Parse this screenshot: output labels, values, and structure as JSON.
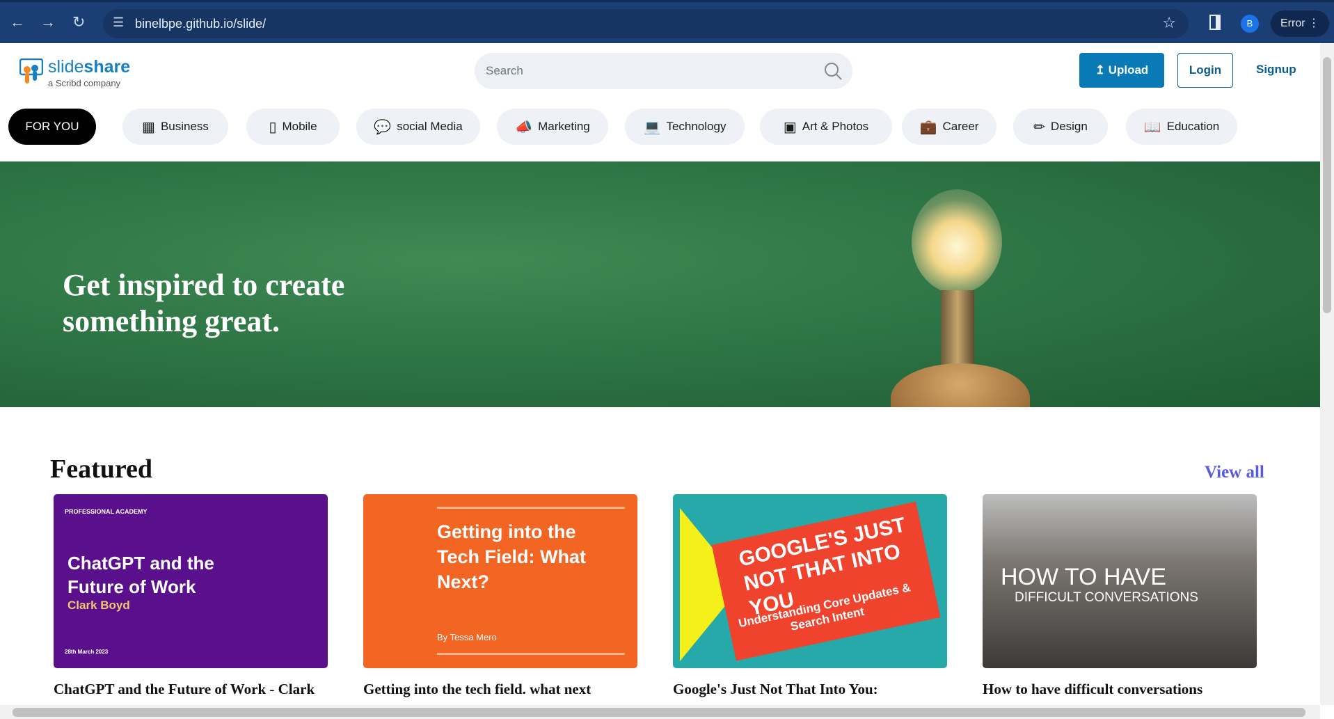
{
  "browser": {
    "url": "binelbpe.github.io/slide/",
    "profile_initial": "B",
    "error_label": "Error"
  },
  "header": {
    "logo_name_light": "slide",
    "logo_name_bold": "share",
    "logo_sub": "a Scribd company",
    "search_placeholder": "Search",
    "upload": "Upload",
    "login": "Login",
    "signup": "Signup"
  },
  "categories": [
    {
      "label": "FOR YOU",
      "icon": "none"
    },
    {
      "label": "Business",
      "icon": "building-icon"
    },
    {
      "label": "Mobile",
      "icon": "phone-icon"
    },
    {
      "label": "social Media",
      "icon": "chat-icon"
    },
    {
      "label": "Marketing",
      "icon": "megaphone-icon"
    },
    {
      "label": "Technology",
      "icon": "monitor-icon"
    },
    {
      "label": "Art & Photos",
      "icon": "image-icon"
    },
    {
      "label": "Career",
      "icon": "briefcase-icon"
    },
    {
      "label": "Design",
      "icon": "brush-icon"
    },
    {
      "label": "Education",
      "icon": "book-icon"
    }
  ],
  "hero": {
    "line1": "Get inspired to create",
    "line2": "something great."
  },
  "featured": {
    "title": "Featured",
    "view_all": "View all",
    "cards": [
      {
        "title": "ChatGPT and the Future of Work - Clark",
        "thumb_text": "ChatGPT and the Future of Work",
        "thumb_sub": "Clark Boyd",
        "thumb_org": "PROFESSIONAL ACADEMY",
        "thumb_date": "28th March 2023",
        "color": "#5a0f8c"
      },
      {
        "title": "Getting into the tech field. what next",
        "thumb_text": "Getting into the Tech Field: What Next?",
        "thumb_sub": "By Tessa Mero",
        "color": "#f26522"
      },
      {
        "title": "Google's Just Not That Into You:",
        "thumb_text": "GOOGLE'S JUST NOT THAT INTO YOU",
        "thumb_sub": "Understanding Core Updates & Search Intent",
        "color": "#26a9a8"
      },
      {
        "title": "How to have difficult conversations",
        "thumb_text": "HOW TO HAVE",
        "thumb_sub": "DIFFICULT CONVERSATIONS",
        "color": "#5b5b5b"
      }
    ]
  }
}
